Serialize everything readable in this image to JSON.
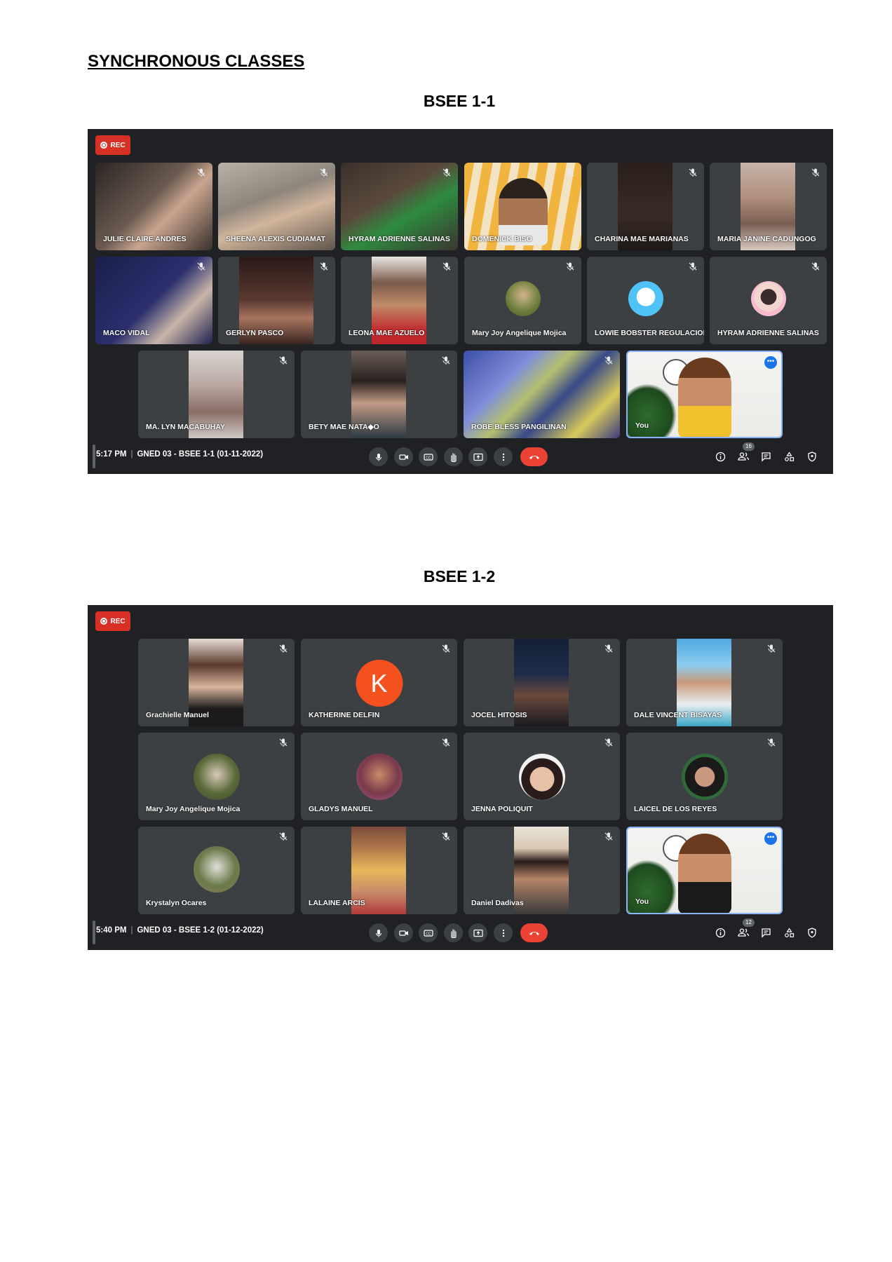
{
  "document": {
    "title": "SYNCHRONOUS CLASSES"
  },
  "sections": [
    {
      "heading": "BSEE 1-1",
      "rec_label": "REC",
      "time": "5:17 PM",
      "separator": "|",
      "meeting_title": "GNED 03 - BSEE 1-1 (01-11-2022)",
      "participants_count": "16",
      "participants": [
        "JULIE CLAIRE ANDRES",
        "SHEENA ALEXIS CUDIAMAT",
        "HYRAM ADRIENNE SALINAS",
        "DOMENICK BISO",
        "CHARINA MAE MARIANAS",
        "MARIA JANINE CADUNGOG",
        "MACO VIDAL",
        "GERLYN PASCO",
        "LEONA MAE AZUELO",
        "Mary Joy Angelique Mojica",
        "LOWIE BOBSTER REGULACION",
        "HYRAM ADRIENNE SALINAS",
        "MA. LYN MACABUHAY",
        "BETY MAE NATA◆O",
        "ROBE BLESS PANGILINAN",
        "You"
      ]
    },
    {
      "heading": "BSEE 1-2",
      "rec_label": "REC",
      "time": "5:40 PM",
      "separator": "|",
      "meeting_title": "GNED 03 - BSEE 1-2 (01-12-2022)",
      "participants_count": "12",
      "avatar_letter": "K",
      "participants": [
        "Grachielle Manuel",
        "KATHERINE DELFIN",
        "JOCEL HITOSIS",
        "DALE VINCENT BISAYAS",
        "Mary Joy Angelique Mojica",
        "GLADYS MANUEL",
        "JENNA POLIQUIT",
        "LAICEL DE LOS REYES",
        "Krystalyn Ocares",
        "LALAINE ARCIS",
        "Daniel Dadivas",
        "You"
      ]
    }
  ],
  "icons": {
    "controls": [
      "mic-icon",
      "camera-icon",
      "captions-icon",
      "raise-hand-icon",
      "present-icon",
      "more-options-icon",
      "end-call-icon"
    ],
    "right_controls": [
      "info-icon",
      "people-icon",
      "chat-icon",
      "activities-icon",
      "host-controls-icon"
    ]
  },
  "colors": {
    "meet_bg": "#202124",
    "tile_bg": "#3c4043",
    "rec_red": "#d93025",
    "end_call_red": "#ea4335",
    "self_border": "#8ab4f8"
  }
}
